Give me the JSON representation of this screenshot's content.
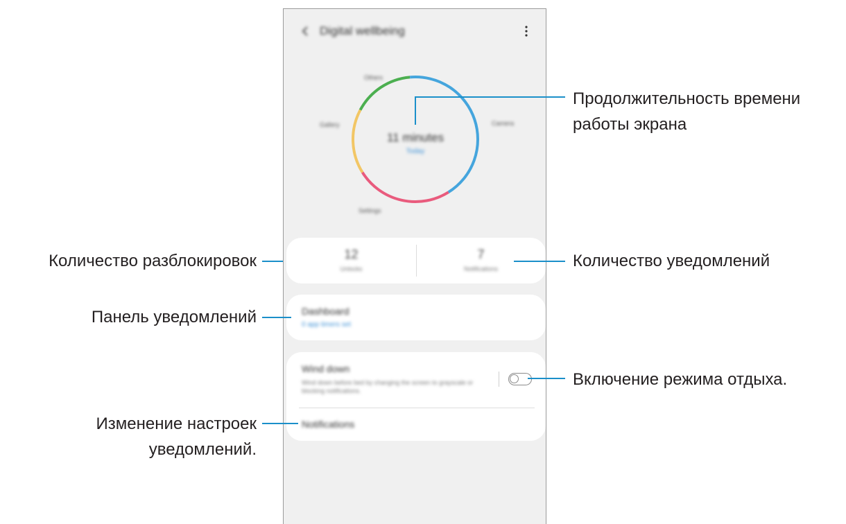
{
  "phone": {
    "title": "Digital wellbeing",
    "icons": {
      "back": "chevron-left-icon",
      "more": "more-vertical-icon"
    },
    "usage_ring": {
      "segments": [
        {
          "app": "Others",
          "color": "#4caf50"
        },
        {
          "app": "Camera",
          "color": "#45a5dd"
        },
        {
          "app": "Settings",
          "color": "#e95b7d"
        },
        {
          "app": "Gallery",
          "color": "#f2c665"
        }
      ],
      "screen_time": "11 minutes",
      "period": "Today"
    },
    "stats": {
      "unlocks_value": "12",
      "unlocks_label": "Unlocks",
      "notifications_value": "7",
      "notifications_label": "Notifications"
    },
    "dashboard": {
      "title": "Dashboard",
      "subtitle": "0 app timers set"
    },
    "wind_down": {
      "title": "Wind down",
      "description": "Wind down before bed by changing the screen to grayscale or blocking notifications.",
      "enabled": false
    },
    "notifications_label": "Notifications"
  },
  "callouts": {
    "screen_time_line1": "Продолжительность времени",
    "screen_time_line2": "работы экрана",
    "unlocks": "Количество разблокировок",
    "notifications_count": "Количество уведомлений",
    "dashboard": "Панель уведомлений",
    "wind_down": "Включение режима отдыха.",
    "notification_settings_line1": "Изменение настроек",
    "notification_settings_line2": "уведомлений."
  },
  "colors": {
    "accent": "#3e91d6",
    "callout_line": "#1a8fc9"
  }
}
